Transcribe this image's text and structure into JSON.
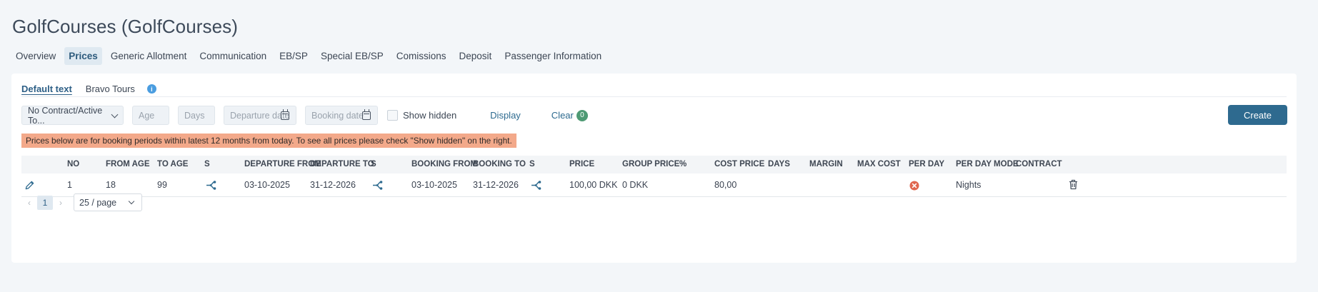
{
  "page": {
    "title": "GolfCourses (GolfCourses)"
  },
  "tabs": [
    {
      "label": "Overview",
      "active": false
    },
    {
      "label": "Prices",
      "active": true
    },
    {
      "label": "Generic Allotment",
      "active": false
    },
    {
      "label": "Communication",
      "active": false
    },
    {
      "label": "EB/SP",
      "active": false
    },
    {
      "label": "Special EB/SP",
      "active": false
    },
    {
      "label": "Comissions",
      "active": false
    },
    {
      "label": "Deposit",
      "active": false
    },
    {
      "label": "Passenger Information",
      "active": false
    }
  ],
  "subtabs": {
    "default": "Default text",
    "bravo": "Bravo Tours",
    "info_icon": "i"
  },
  "filters": {
    "contract_value": "No Contract/Active To...",
    "age_placeholder": "Age",
    "days_placeholder": "Days",
    "departure_placeholder": "Departure date",
    "booking_placeholder": "Booking date",
    "show_hidden_label": "Show hidden",
    "display_label": "Display",
    "clear_label": "Clear",
    "clear_count": "0"
  },
  "create_label": "Create",
  "warning_text": "Prices below are for booking periods within latest 12 months from today. To see all prices please check \"Show hidden\" on the right.",
  "table": {
    "headers": {
      "no": "NO",
      "from_age": "FROM AGE",
      "to_age": "TO AGE",
      "s1": "S",
      "departure_from": "DEPARTURE FROM",
      "departure_to": "DEPARTURE TO",
      "s2": "S",
      "booking_from": "BOOKING FROM",
      "booking_to": "BOOKING TO",
      "s3": "S",
      "price": "PRICE",
      "group_price": "GROUP PRICE",
      "percent": "%",
      "cost_price": "COST PRICE",
      "days": "DAYS",
      "margin": "MARGIN",
      "max_cost": "MAX COST",
      "per_day": "PER DAY",
      "per_day_mode": "PER DAY MODE",
      "contract": "CONTRACT"
    },
    "rows": [
      {
        "no": "1",
        "from_age": "18",
        "to_age": "99",
        "departure_from": "03-10-2025",
        "departure_to": "31-12-2026",
        "booking_from": "03-10-2025",
        "booking_to": "31-12-2026",
        "price": "100,00 DKK",
        "group_price": "0 DKK",
        "cost_price": "80,00",
        "per_day_mode": "Nights"
      }
    ]
  },
  "pagination": {
    "current": "1",
    "page_size": "25 / page",
    "prev": "‹",
    "next": "›"
  },
  "colors": {
    "primary": "#2e6a8f",
    "warning_bg": "#f3a98a",
    "badge_green": "#4e9a74",
    "error_red": "#e0664f"
  }
}
